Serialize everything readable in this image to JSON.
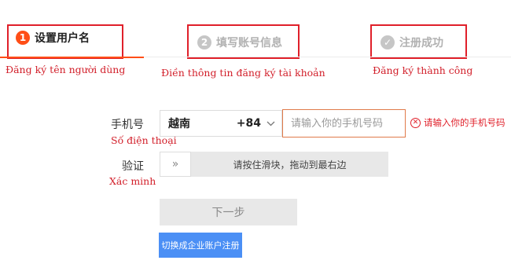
{
  "steps": [
    {
      "number": "1",
      "label": "设置用户名",
      "annotation": "Đăng ký tên người dùng"
    },
    {
      "number": "2",
      "label": "填写账号信息",
      "annotation": "Điền thông tin đăng ký tài khoản"
    },
    {
      "number": "✓",
      "label": "注册成功",
      "annotation": "Đăng ký thành công"
    }
  ],
  "form": {
    "phone_label": "手机号",
    "phone_annotation": "Số điện thoại",
    "country_name": "越南",
    "country_code": "+84",
    "phone_placeholder": "请输入你的手机号码",
    "phone_error": "请输入你的手机号码",
    "verify_label": "验证",
    "verify_annotation": "Xác minh",
    "slider_handle": "»",
    "slider_text": "请按住滑块，拖动到最右边",
    "next_button": "下一步",
    "corp_button": "切换成企业账户注册"
  },
  "colors": {
    "accent": "#ff4e17",
    "highlight_border": "#e0202a",
    "annotation_text": "#d21f2a",
    "error": "#e0202a",
    "corp_button_bg": "#4b8ff5",
    "disabled_bg": "#e8e8e8"
  }
}
